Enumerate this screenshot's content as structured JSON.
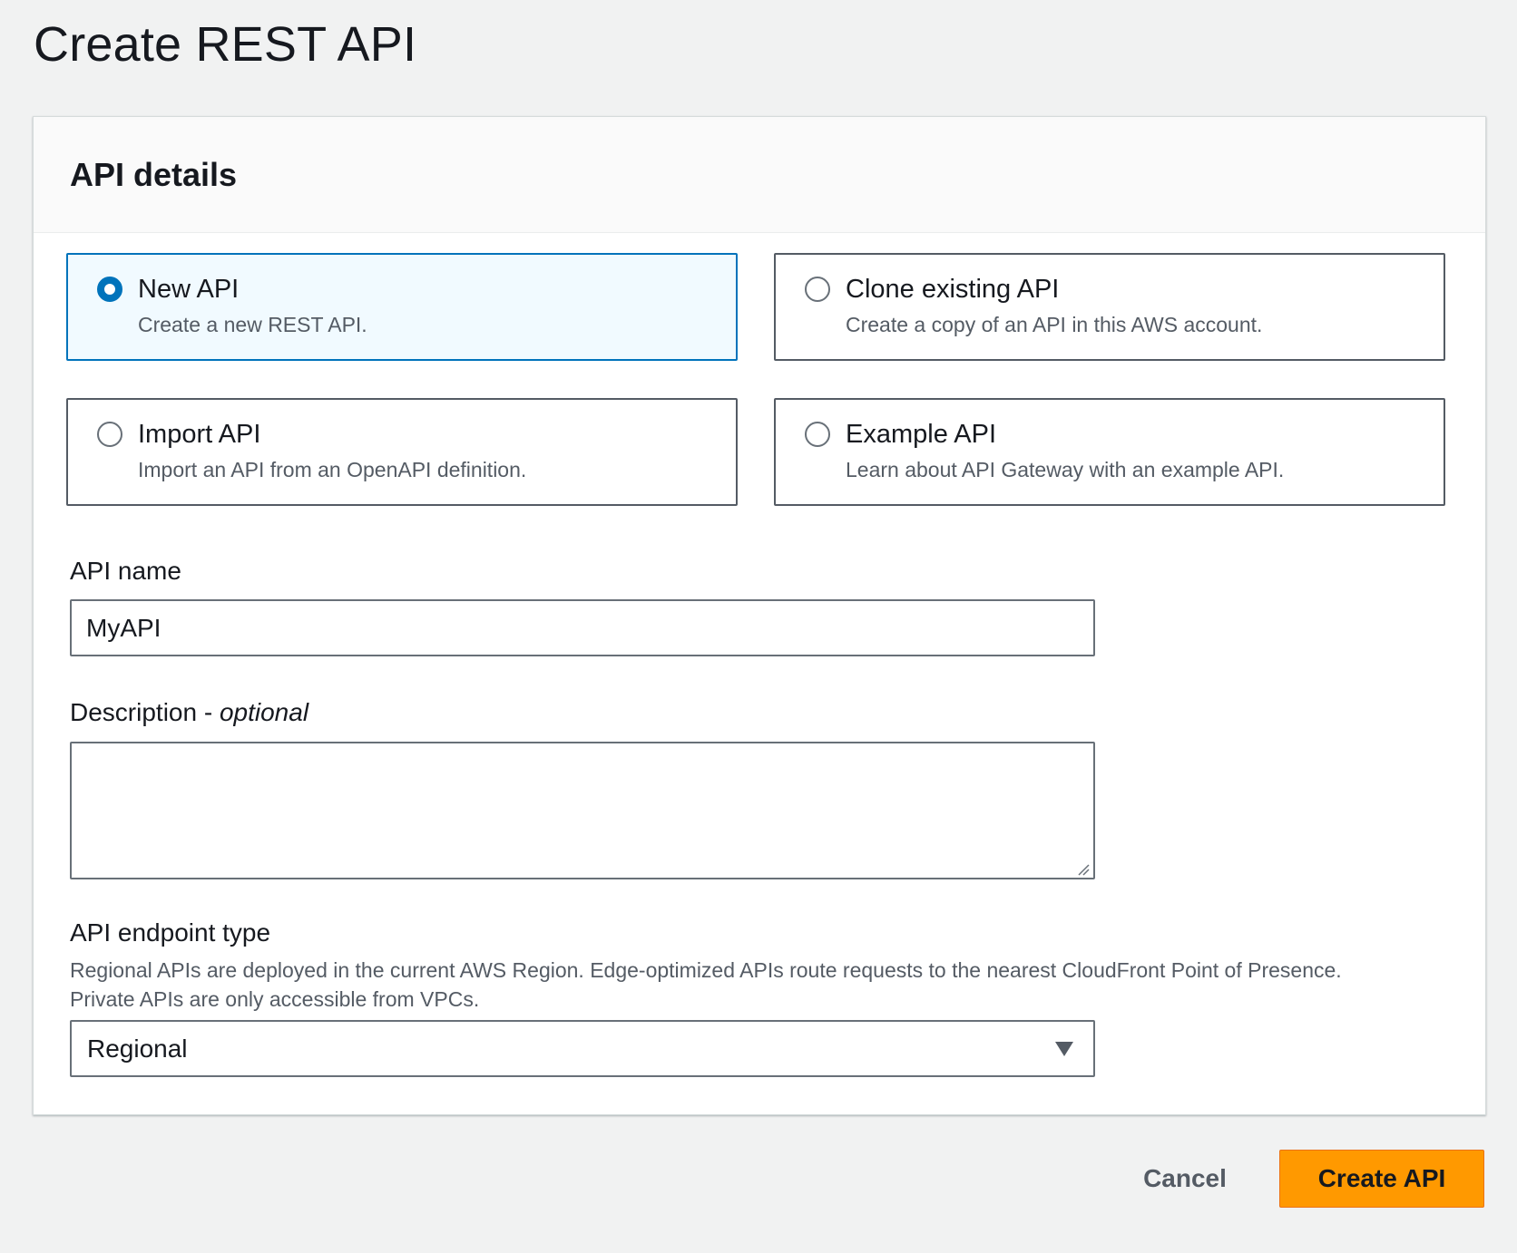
{
  "page": {
    "title": "Create REST API"
  },
  "panel": {
    "header": "API details",
    "options": [
      {
        "title": "New API",
        "description": "Create a new REST API.",
        "selected": true
      },
      {
        "title": "Clone existing API",
        "description": "Create a copy of an API in this AWS account.",
        "selected": false
      },
      {
        "title": "Import API",
        "description": "Import an API from an OpenAPI definition.",
        "selected": false
      },
      {
        "title": "Example API",
        "description": "Learn about API Gateway with an example API.",
        "selected": false
      }
    ],
    "api_name": {
      "label": "API name",
      "value": "MyAPI"
    },
    "description": {
      "label": "Description -",
      "label_suffix": "optional",
      "value": ""
    },
    "endpoint_type": {
      "label": "API endpoint type",
      "help_line1": "Regional APIs are deployed in the current AWS Region. Edge-optimized APIs route requests to the nearest CloudFront Point of Presence.",
      "help_line2": "Private APIs are only accessible from VPCs.",
      "selected": "Regional"
    }
  },
  "footer": {
    "cancel_label": "Cancel",
    "create_label": "Create API"
  },
  "colors": {
    "accent_blue": "#0073bb",
    "primary_button": "#ff9900",
    "background": "#f1f2f2"
  }
}
